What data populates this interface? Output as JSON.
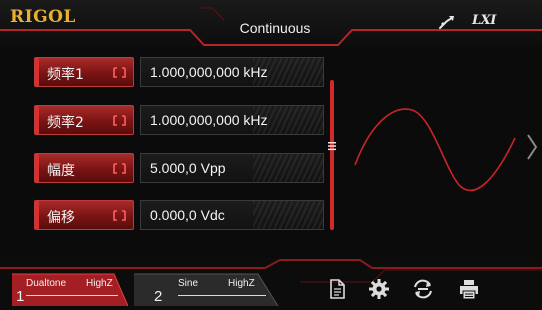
{
  "header": {
    "brand": "RIGOL",
    "mode": "Continuous",
    "usb_icon": "usb-icon",
    "lxi_label": "LXI"
  },
  "params": [
    {
      "label": "频率1",
      "value": "1.000,000,000 kHz",
      "active": true,
      "icon": "swap-icon"
    },
    {
      "label": "频率2",
      "value": "1.000,000,000 kHz",
      "active": false,
      "icon": "swap-icon"
    },
    {
      "label": "幅度",
      "value": "5.000,0 Vpp",
      "active": false,
      "icon": "swap-icon"
    },
    {
      "label": "偏移",
      "value": "0.000,0 Vdc",
      "active": false,
      "icon": "swap-icon"
    }
  ],
  "waveform": {
    "type": "sine",
    "icon": "sine-wave-preview"
  },
  "channels": [
    {
      "number": "1",
      "waveform": "Dualtone",
      "impedance": "HighZ",
      "selected": true
    },
    {
      "number": "2",
      "waveform": "Sine",
      "impedance": "HighZ",
      "selected": false
    }
  ],
  "toolbar": {
    "icons": [
      "file-icon",
      "gear-icon",
      "sync-icon",
      "printer-icon"
    ]
  },
  "colors": {
    "accent_red": "#c0262b",
    "brand_gold": "#e8b230",
    "background": "#0b0b0b"
  }
}
